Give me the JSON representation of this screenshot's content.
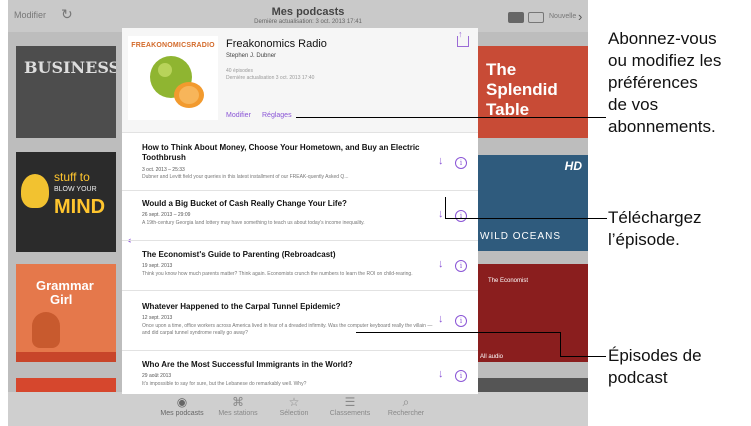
{
  "statusbar": {
    "left_label": "Modifier",
    "title": "Mes podcasts",
    "subtitle": "Dernière actualisation: 3 oct. 2013 17:41",
    "right_label": "Nouvelle"
  },
  "podcast": {
    "artwork_title": "FREAKONOMICSRADIO",
    "title": "Freakonomics Radio",
    "author": "Stephen J. Dubner",
    "meta_line1": "40 épisodes",
    "meta_line2": "Dernière actualisation 3 oct. 2013 17:40",
    "modify_label": "Modifier",
    "settings_label": "Réglages"
  },
  "episodes": [
    {
      "title": "How to Think About Money, Choose Your Hometown, and Buy an Electric Toothbrush",
      "date": "3 oct. 2013 – 25:33",
      "desc": "Dubner and Levitt field your queries in this latest installment of our FREAK-quently Asked Q..."
    },
    {
      "title": "Would a Big Bucket of Cash Really Change Your Life?",
      "date": "26 sept. 2013 – 29:09",
      "desc": "A 19th-century Georgia land lottery may have something to teach us about today's income inequality."
    },
    {
      "title": "The Economist's Guide to Parenting (Rebroadcast)",
      "date": "19 sept. 2013",
      "desc": "Think you know how much parents matter? Think again. Economists crunch the numbers to learn the ROI on child-rearing."
    },
    {
      "title": "Whatever Happened to the Carpal Tunnel Epidemic?",
      "date": "12 sept. 2013",
      "desc": "Once upon a time, office workers across America lived in fear of a dreaded infirmity. Was the computer keyboard really the villain — and did carpal tunnel syndrome really go away?"
    },
    {
      "title": "Who Are the Most Successful Immigrants in the World?",
      "date": "29 août 2013",
      "desc": "It's impossible to say for sure, but the Lebanese do remarkably well. Why?"
    }
  ],
  "background_tiles": {
    "business": "BUSINESS",
    "stuff_line1": "stuff to",
    "stuff_line2": "BLOW YOUR",
    "stuff_line3": "MIND",
    "grammar_line1": "Grammar",
    "grammar_line2": "Girl",
    "splendid_line1": "The",
    "splendid_line2": "Splendid",
    "splendid_line3": "Table",
    "hd": "HD",
    "wild_oceans": "WILD OCEANS",
    "economist": "The Economist",
    "all_audio": "All audio"
  },
  "tabbar": {
    "items": [
      "Mes podcasts",
      "Mes stations",
      "Sélection",
      "Classements",
      "Rechercher"
    ]
  },
  "callouts": {
    "subscribe": [
      "Abonnez-vous",
      "ou modifiez les",
      "préférences",
      "de vos",
      "abonnements."
    ],
    "download": [
      "Téléchargez",
      "l’épisode."
    ],
    "episodes": [
      "Épisodes de",
      "podcast"
    ]
  },
  "colors": {
    "accent": "#8a55d6",
    "artwork_title": "#d36a2a"
  },
  "icons": {
    "refresh": "refresh-icon",
    "share": "share-icon",
    "download": "download-arrow-icon",
    "info": "info-icon",
    "speaker": "speaker-icon"
  }
}
